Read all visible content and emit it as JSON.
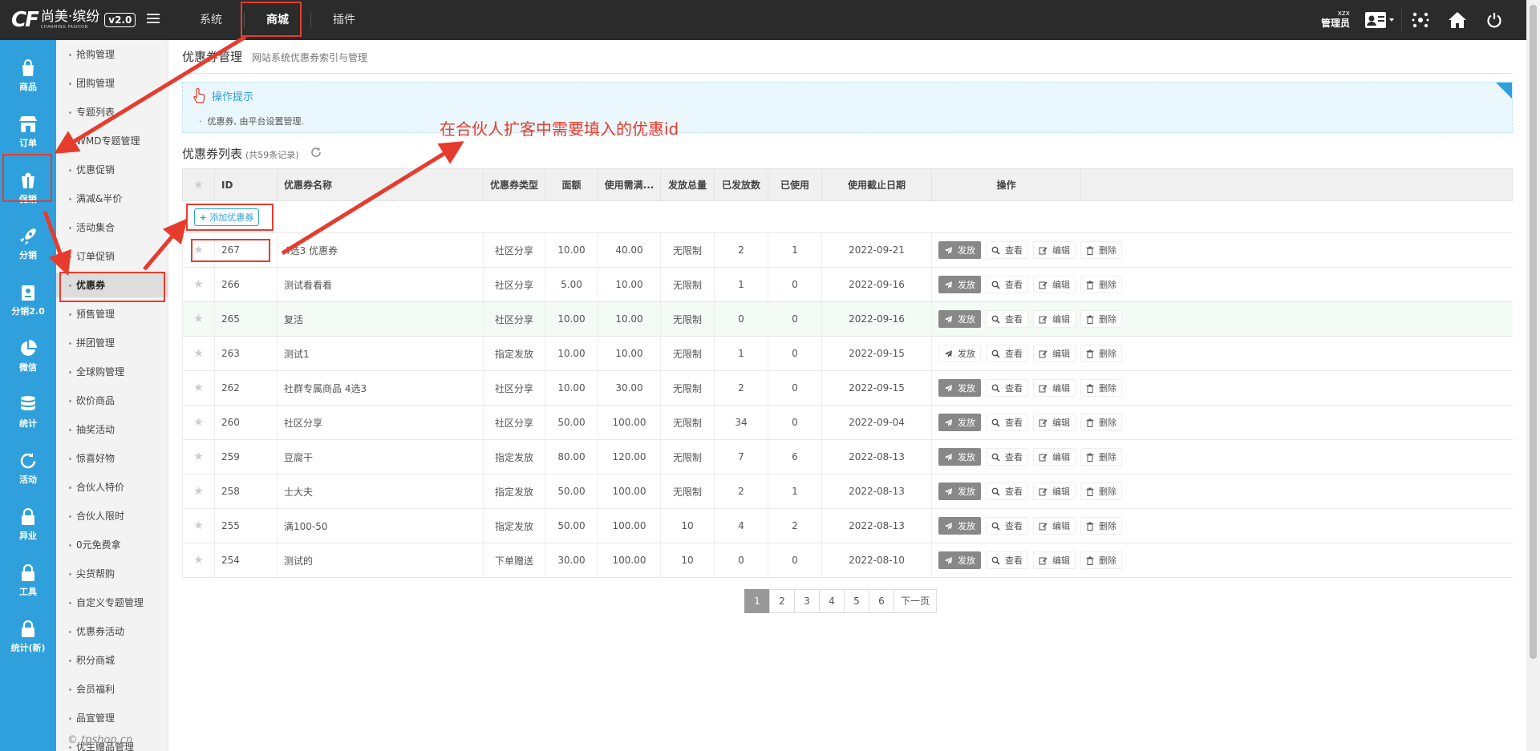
{
  "brand": {
    "cf": "CF",
    "name_cn": "尚美·缤纷",
    "name_en": "CHARMING FASHION",
    "version": "v2.0"
  },
  "topnav": {
    "tabs": [
      {
        "label": "系统"
      },
      {
        "label": "商城"
      },
      {
        "label": "插件"
      }
    ],
    "active": "商城"
  },
  "user": {
    "name": "xzx",
    "role": "管理员"
  },
  "iconbar": {
    "items": [
      {
        "label": "商品",
        "icon": "bag-icon"
      },
      {
        "label": "订单",
        "icon": "store-icon"
      },
      {
        "label": "促销",
        "icon": "gift-icon"
      },
      {
        "label": "分销",
        "icon": "rocket-icon"
      },
      {
        "label": "分销2.0",
        "icon": "badge-icon"
      },
      {
        "label": "微信",
        "icon": "pie-icon"
      },
      {
        "label": "统计",
        "icon": "database-icon"
      },
      {
        "label": "活动",
        "icon": "refresh-icon"
      },
      {
        "label": "异业",
        "icon": "lock-icon"
      },
      {
        "label": "工具",
        "icon": "lock-icon"
      },
      {
        "label": "统计(新)",
        "icon": "lock-icon"
      }
    ],
    "active": "促销"
  },
  "submenu": {
    "items": [
      "抢购管理",
      "团购管理",
      "专题列表",
      "WMD专题管理",
      "优惠促销",
      "满减&半价",
      "活动集合",
      "订单促销",
      "优惠券",
      "预售管理",
      "拼团管理",
      "全球购管理",
      "砍价商品",
      "抽奖活动",
      "惊喜好物",
      "合伙人特价",
      "合伙人限时",
      "0元免费拿",
      "尖货帮购",
      "自定义专题管理",
      "优惠券活动",
      "积分商城",
      "会员福利",
      "品宣管理",
      "优生赠品管理"
    ],
    "active": "优惠券",
    "copyright": "© tpshop.cn"
  },
  "page": {
    "title": "优惠券管理",
    "subtitle": "网站系统优惠券索引与管理"
  },
  "tips": {
    "title": "操作提示",
    "body": "优惠券, 由平台设置管理."
  },
  "list": {
    "title": "优惠券列表",
    "count": "(共59条记录)",
    "add_label": "添加优惠券"
  },
  "table": {
    "headers": [
      "",
      "ID",
      "优惠券名称",
      "优惠券类型",
      "面额",
      "使用需满...",
      "发放总量",
      "已发放数",
      "已使用",
      "使用截止日期",
      "操作"
    ],
    "ops": {
      "send": "发放",
      "view": "查看",
      "edit": "编辑",
      "delete": "删除"
    },
    "rows": [
      {
        "id": "267",
        "name": "4选3 优惠券",
        "type": "社区分享",
        "amount": "10.00",
        "min": "40.00",
        "total": "无限制",
        "issued": "2",
        "used": "1",
        "deadline": "2022-09-21",
        "send_style": "dark"
      },
      {
        "id": "266",
        "name": "测试看看看",
        "type": "社区分享",
        "amount": "5.00",
        "min": "10.00",
        "total": "无限制",
        "issued": "1",
        "used": "0",
        "deadline": "2022-09-16",
        "send_style": "dark"
      },
      {
        "id": "265",
        "name": "复活",
        "type": "社区分享",
        "amount": "10.00",
        "min": "10.00",
        "total": "无限制",
        "issued": "0",
        "used": "0",
        "deadline": "2022-09-16",
        "send_style": "dark"
      },
      {
        "id": "263",
        "name": "测试1",
        "type": "指定发放",
        "amount": "10.00",
        "min": "10.00",
        "total": "无限制",
        "issued": "1",
        "used": "0",
        "deadline": "2022-09-15",
        "send_style": "lite"
      },
      {
        "id": "262",
        "name": "社群专属商品 4选3",
        "type": "社区分享",
        "amount": "10.00",
        "min": "30.00",
        "total": "无限制",
        "issued": "2",
        "used": "0",
        "deadline": "2022-09-15",
        "send_style": "dark"
      },
      {
        "id": "260",
        "name": "社区分享",
        "type": "社区分享",
        "amount": "50.00",
        "min": "100.00",
        "total": "无限制",
        "issued": "34",
        "used": "0",
        "deadline": "2022-09-04",
        "send_style": "dark"
      },
      {
        "id": "259",
        "name": "豆腐干",
        "type": "指定发放",
        "amount": "80.00",
        "min": "120.00",
        "total": "无限制",
        "issued": "7",
        "used": "6",
        "deadline": "2022-08-13",
        "send_style": "dark"
      },
      {
        "id": "258",
        "name": "士大夫",
        "type": "指定发放",
        "amount": "50.00",
        "min": "100.00",
        "total": "无限制",
        "issued": "2",
        "used": "1",
        "deadline": "2022-08-13",
        "send_style": "dark"
      },
      {
        "id": "255",
        "name": "满100-50",
        "type": "指定发放",
        "amount": "50.00",
        "min": "100.00",
        "total": "10",
        "issued": "4",
        "used": "2",
        "deadline": "2022-08-13",
        "send_style": "dark"
      },
      {
        "id": "254",
        "name": "测试的",
        "type": "下单赠送",
        "amount": "30.00",
        "min": "100.00",
        "total": "10",
        "issued": "0",
        "used": "0",
        "deadline": "2022-08-10",
        "send_style": "dark"
      }
    ]
  },
  "pager": {
    "pages": [
      "1",
      "2",
      "3",
      "4",
      "5",
      "6"
    ],
    "next": "下一页",
    "current": "1"
  },
  "annotation": {
    "text": "在合伙人扩客中需要填入的优惠id",
    "color": "#e63c2e"
  },
  "colors": {
    "topbar": "#2b2b2b",
    "sidebar": "#2fa0dc",
    "highlight": "#e63c2e"
  }
}
